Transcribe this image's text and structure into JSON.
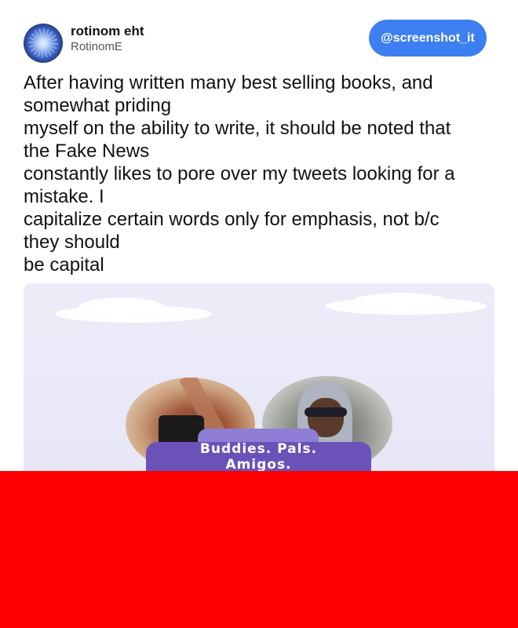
{
  "author": {
    "name": "rotinom eht",
    "handle": "RotinomE",
    "avatar_icon": "avatar-image"
  },
  "brand": {
    "label": "@screenshot_it",
    "color": "#3d7ef0"
  },
  "tweet": {
    "lines": [
      "After having written many best selling books, and",
      "somewhat priding",
      "myself on the ability to write, it should be noted that",
      "the Fake News",
      "constantly likes to pore over my tweets looking for a",
      "mistake. I",
      "capitalize certain words only for emphasis, not b/c",
      "they should",
      "be capital"
    ]
  },
  "media": {
    "banner_lines": [
      "Buddies. Pals.",
      "Amigos."
    ],
    "banner_color": "#6b52b8"
  },
  "overlay": {
    "color": "#ff0000"
  }
}
